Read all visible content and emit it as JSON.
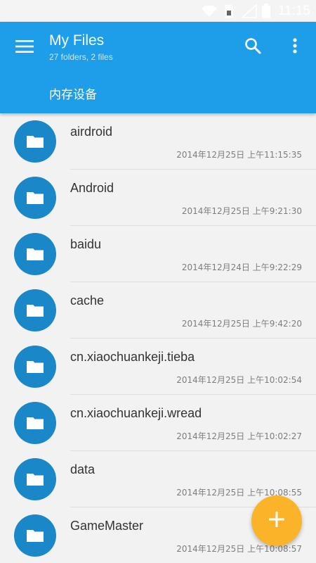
{
  "status_bar": {
    "time": "11:15",
    "icons": [
      "wifi-icon",
      "sim-card-icon",
      "signal-icon",
      "battery-icon"
    ]
  },
  "app_bar": {
    "title": "My Files",
    "subtitle": "27 folders, 2 files",
    "path": "内存设备",
    "icons": [
      "menu-icon",
      "search-icon",
      "more-vert-icon"
    ]
  },
  "files": [
    {
      "name": "airdroid",
      "date": "2014年12月25日 上午11:15:35"
    },
    {
      "name": "Android",
      "date": "2014年12月25日 上午9:21:30"
    },
    {
      "name": "baidu",
      "date": "2014年12月24日 上午9:22:29"
    },
    {
      "name": "cache",
      "date": "2014年12月25日 上午9:42:20"
    },
    {
      "name": "cn.xiaochuankeji.tieba",
      "date": "2014年12月25日 上午10:02:54"
    },
    {
      "name": "cn.xiaochuankeji.wread",
      "date": "2014年12月25日 上午10:02:27"
    },
    {
      "name": "data",
      "date": "2014年12月25日 上午10:08:55"
    },
    {
      "name": "GameMaster",
      "date": "2014年12月25日 上午10:08:57"
    }
  ],
  "fab": {
    "icon": "plus-icon"
  },
  "colors": {
    "primary": "#1e9ee9",
    "folder_circle": "#1a88c8",
    "fab": "#fbb42a"
  }
}
